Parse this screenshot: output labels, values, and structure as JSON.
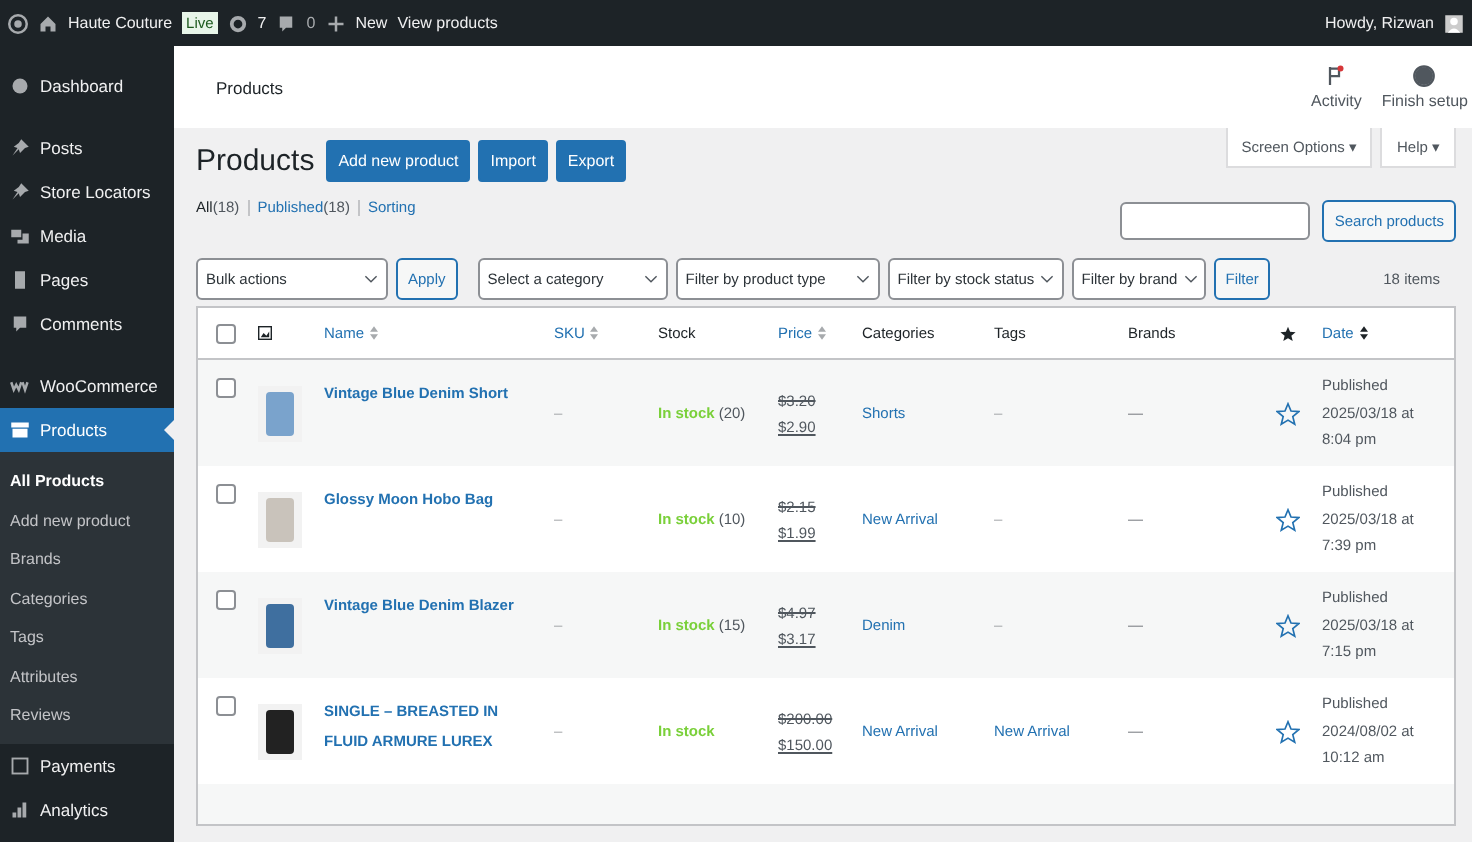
{
  "admin_bar": {
    "site": "Haute Couture",
    "live_badge": "Live",
    "updates": "7",
    "comments": "0",
    "new": "New",
    "view": "View products",
    "greeting": "Howdy, Rizwan"
  },
  "sidebar": {
    "items": [
      {
        "label": "Dashboard",
        "selected": false
      },
      {
        "label": "Posts",
        "selected": false
      },
      {
        "label": "Store Locators",
        "selected": false
      },
      {
        "label": "Media",
        "selected": false
      },
      {
        "label": "Pages",
        "selected": false
      },
      {
        "label": "Comments",
        "selected": false
      },
      {
        "label": "WooCommerce",
        "selected": false
      },
      {
        "label": "Products",
        "selected": true,
        "children": [
          {
            "label": "All Products",
            "selected": true
          },
          {
            "label": "Add new product",
            "selected": false
          },
          {
            "label": "Brands",
            "selected": false
          },
          {
            "label": "Categories",
            "selected": false
          },
          {
            "label": "Tags",
            "selected": false
          },
          {
            "label": "Attributes",
            "selected": false
          },
          {
            "label": "Reviews",
            "selected": false
          }
        ]
      },
      {
        "label": "Payments",
        "selected": false
      },
      {
        "label": "Analytics",
        "selected": false
      }
    ]
  },
  "header": {
    "title": "Products",
    "activity": "Activity",
    "finish_setup": "Finish setup"
  },
  "screen_options": "Screen Options ▾",
  "help": "Help ▾",
  "page_title": "Products",
  "actions": [
    "Add new product",
    "Import",
    "Export"
  ],
  "views": [
    {
      "label": "All",
      "count": "(18)",
      "selected": true
    },
    {
      "label": "Published",
      "count": "(18)",
      "selected": false
    },
    {
      "label": "Sorting",
      "selected": false
    }
  ],
  "search_button": "Search products",
  "filters": {
    "bulk": "Bulk actions",
    "apply": "Apply",
    "selects": [
      "Select a category",
      "Filter by product type",
      "Filter by stock status",
      "Filter by brand"
    ],
    "filter": "Filter",
    "count": "18 items"
  },
  "table": {
    "select_all_checked": false,
    "columns": [
      {
        "label": "Name",
        "sortable": true
      },
      {
        "label": "SKU",
        "sortable": true
      },
      {
        "label": "Stock",
        "sortable": false
      },
      {
        "label": "Price",
        "sortable": true
      },
      {
        "label": "Categories",
        "sortable": false
      },
      {
        "label": "Tags",
        "sortable": false
      },
      {
        "label": "Brands",
        "sortable": false
      },
      {
        "label": "Date",
        "sortable": true
      }
    ],
    "rows": [
      {
        "name": "Vintage Blue Denim Short",
        "sku": "–",
        "stock": "In stock",
        "stock_count": "(20)",
        "old_price": "$3.20",
        "price": "$2.90",
        "categories": "Shorts",
        "tags": "–",
        "brands": "—",
        "featured": false,
        "checked": false,
        "date": "Published 2025/03/18 at 8:04 pm"
      },
      {
        "name": "Glossy Moon Hobo Bag",
        "sku": "–",
        "stock": "In stock",
        "stock_count": "(10)",
        "old_price": "$2.15",
        "price": "$1.99",
        "categories": "New Arrival",
        "tags": "–",
        "brands": "—",
        "featured": false,
        "checked": false,
        "date": "Published 2025/03/18 at 7:39 pm"
      },
      {
        "name": "Vintage Blue Denim Blazer",
        "sku": "–",
        "stock": "In stock",
        "stock_count": "(15)",
        "old_price": "$4.97",
        "price": "$3.17",
        "categories": "Denim",
        "tags": "–",
        "brands": "—",
        "featured": false,
        "checked": false,
        "date": "Published 2025/03/18 at 7:15 pm"
      },
      {
        "name": "SINGLE – BREASTED IN FLUID ARMURE LUREX",
        "sku": "–",
        "stock": "In stock",
        "old_price": "$200.00",
        "price": "$150.00",
        "categories": "New Arrival",
        "tags": "New Arrival",
        "brands": "—",
        "featured": false,
        "checked": false,
        "date": "Published 2024/08/02 at 10:12 am"
      }
    ]
  }
}
